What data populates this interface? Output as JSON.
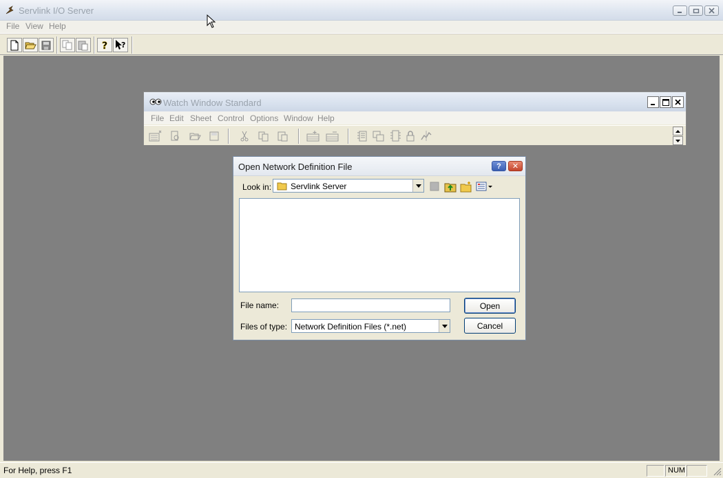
{
  "main_window": {
    "title": "Servlink I/O Server",
    "menu": [
      "File",
      "View",
      "Help"
    ],
    "toolbar": [
      "new-icon",
      "open-icon",
      "save-icon",
      "copy-icon",
      "paste-icon",
      "about-icon",
      "context-help-icon"
    ]
  },
  "watch_window": {
    "title": "Watch Window Standard",
    "menu": [
      "File",
      "Edit",
      "Sheet",
      "Control",
      "Options",
      "Window",
      "Help"
    ]
  },
  "dialog": {
    "title": "Open Network Definition File",
    "help_btn": "?",
    "close_btn": "✕",
    "lookin_label": "Look in:",
    "lookin_value": "Servlink Server",
    "filename_label": "File name:",
    "filename_value": "",
    "filetype_label": "Files of type:",
    "filetype_value": "Network Definition Files (*.net)",
    "open_label": "Open",
    "cancel_label": "Cancel"
  },
  "statusbar": {
    "text": "For Help, press F1",
    "num": "NUM"
  },
  "colors": {
    "mdi_background": "#808080",
    "chrome": "#ece9d8",
    "disabled_text": "#9aa3ad"
  }
}
